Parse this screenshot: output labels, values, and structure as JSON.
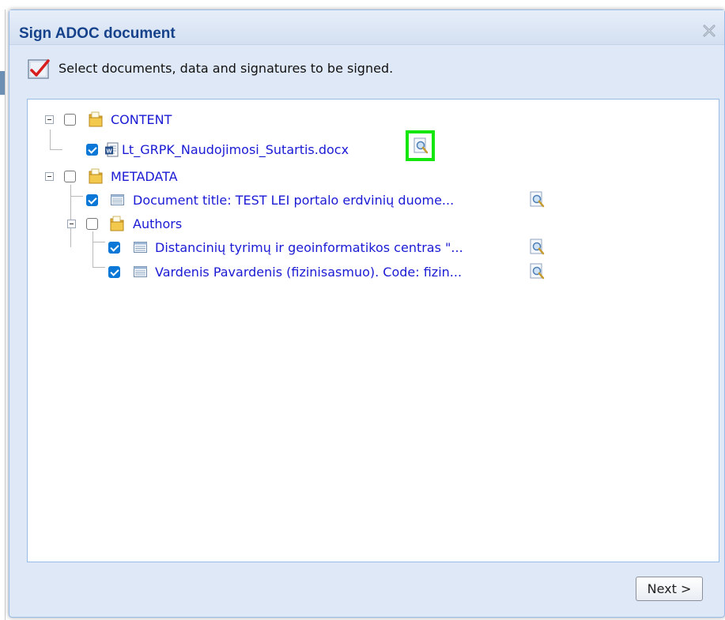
{
  "dialog": {
    "title": "Sign ADOC document",
    "instruction": "Select documents, data and signatures to be signed.",
    "next_label": "Next >"
  },
  "tree": {
    "content": {
      "label": "CONTENT",
      "checked": false,
      "file": {
        "label": "Lt_GRPK_Naudojimosi_Sutartis.docx",
        "checked": true,
        "icon": "word-doc-icon"
      }
    },
    "metadata": {
      "label": "METADATA",
      "checked": false,
      "doc_title": {
        "label": "Document title: TEST LEI portalo erdvinių duome...",
        "checked": true
      },
      "authors": {
        "label": "Authors",
        "checked": false,
        "items": [
          {
            "label": "Distancinių tyrimų ir geoinformatikos centras \"...",
            "checked": true
          },
          {
            "label": "Vardenis Pavardenis (fizinisasmuo). Code: fizin...",
            "checked": true
          }
        ]
      }
    }
  },
  "colors": {
    "title": "#15428b",
    "link": "#1a1ad4",
    "highlight": "#14e60e",
    "checkbox": "#0b78d7"
  }
}
